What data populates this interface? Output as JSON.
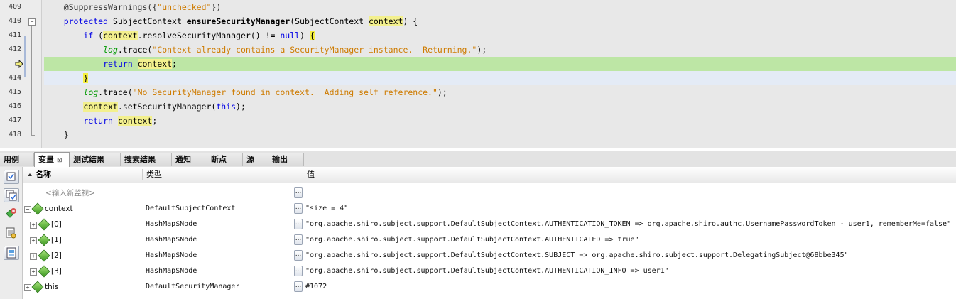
{
  "editor": {
    "line_numbers": [
      "409",
      "410",
      "411",
      "412",
      "",
      "414",
      "415",
      "416",
      "417",
      "418"
    ],
    "code": {
      "l409": {
        "ann": "@SuppressWarnings({",
        "str": "\"unchecked\"",
        "end": "})"
      },
      "l410": {
        "kw": "protected",
        "t1": " SubjectContext ",
        "method": "ensureSecurityManager",
        "t2": "(SubjectContext ",
        "var": "context",
        "t3": ") {"
      },
      "l411": {
        "kw": "if",
        "t1": " (",
        "var": "context",
        "t2": ".resolveSecurityManager() != ",
        "kw2": "null",
        "t3": ") ",
        "brace": "{"
      },
      "l412": {
        "log": "log",
        "t1": ".trace(",
        "str": "\"Context already contains a SecurityManager instance.  Returning.\"",
        "t2": ");"
      },
      "l413": {
        "kw": "return",
        "t1": " ",
        "var": "context",
        "t2": ";"
      },
      "l414": {
        "brace": "}"
      },
      "l415": {
        "log": "log",
        "t1": ".trace(",
        "str": "\"No SecurityManager found in context.  Adding self reference.\"",
        "t2": ");"
      },
      "l416": {
        "var": "context",
        "t1": ".setSecurityManager(",
        "kw": "this",
        "t2": ");"
      },
      "l417": {
        "kw": "return",
        "t1": " ",
        "var": "context",
        "t2": ";"
      },
      "l418": {
        "t1": "}"
      }
    }
  },
  "tabs": [
    {
      "label": "用例"
    },
    {
      "label": "变量",
      "close": "⊠"
    },
    {
      "label": "测试结果"
    },
    {
      "label": "搜索结果"
    },
    {
      "label": "通知"
    },
    {
      "label": "断点"
    },
    {
      "label": "源"
    },
    {
      "label": "输出"
    }
  ],
  "variables": {
    "columns": {
      "name": "名称",
      "type": "类型",
      "value": "值"
    },
    "new_watch_placeholder": "<输入新监视>",
    "dots_label": "...",
    "rows": [
      {
        "name": "context",
        "type": "DefaultSubjectContext",
        "value": "\"size = 4\""
      },
      {
        "name": "[0]",
        "type": "HashMap$Node",
        "value": "\"org.apache.shiro.subject.support.DefaultSubjectContext.AUTHENTICATION_TOKEN => org.apache.shiro.authc.UsernamePasswordToken - user1, rememberMe=false\""
      },
      {
        "name": "[1]",
        "type": "HashMap$Node",
        "value": "\"org.apache.shiro.subject.support.DefaultSubjectContext.AUTHENTICATED => true\""
      },
      {
        "name": "[2]",
        "type": "HashMap$Node",
        "value": "\"org.apache.shiro.subject.support.DefaultSubjectContext.SUBJECT => org.apache.shiro.subject.support.DelegatingSubject@68bbe345\""
      },
      {
        "name": "[3]",
        "type": "HashMap$Node",
        "value": "\"org.apache.shiro.subject.support.DefaultSubjectContext.AUTHENTICATION_INFO => user1\""
      },
      {
        "name": "this",
        "type": "DefaultSecurityManager",
        "value": "#1072"
      }
    ]
  },
  "colors": {
    "current_line": "#bde6a5",
    "keyword": "#0000e6",
    "string": "#ce7b00",
    "log": "#009900"
  }
}
